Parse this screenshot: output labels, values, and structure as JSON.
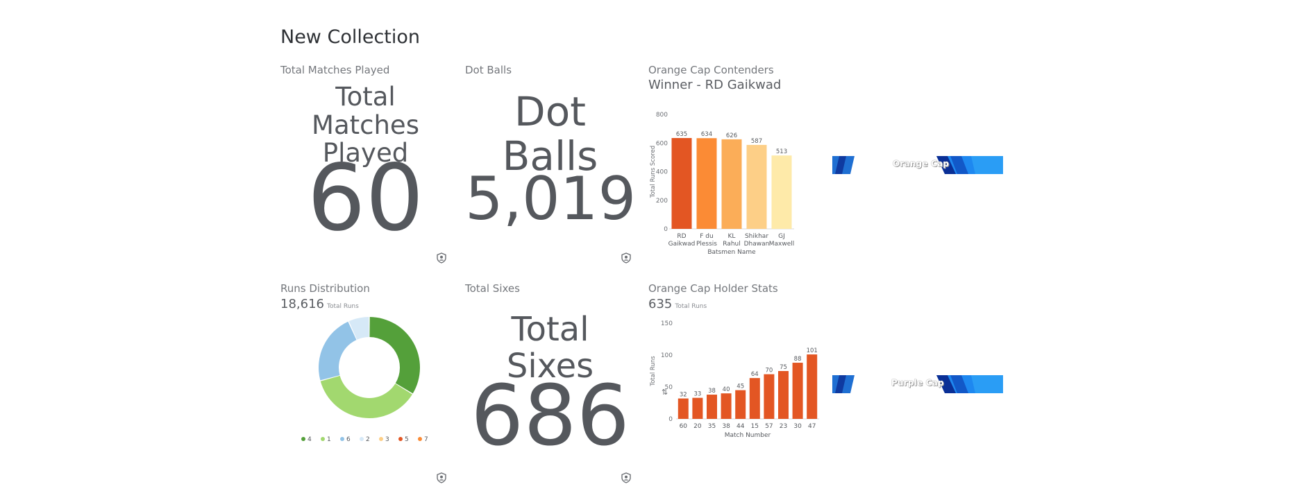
{
  "page_title": "New Collection",
  "cards": {
    "matches": {
      "label": "Total Matches Played",
      "title_line1": "Total Matches",
      "title_line2": "Played",
      "value": "60"
    },
    "dot_balls": {
      "label": "Dot Balls",
      "title": "Dot Balls",
      "value": "5,019"
    },
    "orange_cap": {
      "label": "Orange Cap Contenders",
      "subtitle": "Winner - RD Gaikwad"
    },
    "runs_dist": {
      "label": "Runs Distribution",
      "total": "18,616",
      "total_unit": "Total Runs"
    },
    "sixes": {
      "label": "Total Sixes",
      "title": "Total Sixes",
      "value": "686"
    },
    "holder_stats": {
      "label": "Orange Cap Holder Stats",
      "total": "635",
      "total_unit": "Total Runs"
    }
  },
  "banners": {
    "orange": {
      "text": "Orange Cap"
    },
    "purple": {
      "text": "Purple Cap"
    }
  },
  "colors": {
    "orange_bar": "#e35623",
    "green": "#54a03a"
  },
  "chart_data": [
    {
      "type": "bar",
      "title": "",
      "xlabel": "Batsmen Name",
      "ylabel": "Total Runs Scored",
      "ylim": [
        0,
        800
      ],
      "yticks": [
        "0",
        "200",
        "400",
        "600",
        "800"
      ],
      "categories": [
        [
          "RD",
          "Gaikwad"
        ],
        [
          "F du",
          "Plessis"
        ],
        [
          "KL",
          "Rahul"
        ],
        [
          "Shikhar",
          "Dhawan"
        ],
        [
          "GJ",
          "Maxwell"
        ]
      ],
      "values": [
        635,
        634,
        626,
        587,
        513
      ],
      "value_labels": [
        "635",
        "634",
        "626",
        "587",
        "513"
      ],
      "colors": [
        "#e35623",
        "#fb8b35",
        "#fbad58",
        "#fdcf87",
        "#feeaa9"
      ],
      "grid": false
    },
    {
      "type": "pie",
      "donut": true,
      "categories": [
        "4",
        "1",
        "6",
        "2",
        "3",
        "5",
        "7"
      ],
      "values": [
        30,
        33,
        20,
        6,
        0,
        0,
        0
      ],
      "colors": [
        "#54a03a",
        "#a2d86f",
        "#92c3e7",
        "#d6e9f7",
        "#fdcf87",
        "#e35623",
        "#fb8b35"
      ],
      "legend": "bottom"
    },
    {
      "type": "bar",
      "title": "",
      "xlabel": "Match Number",
      "ylabel": "Total Runs",
      "ylim": [
        0,
        150
      ],
      "yticks": [
        "0",
        "50",
        "100",
        "150"
      ],
      "categories": [
        "60",
        "20",
        "35",
        "38",
        "44",
        "15",
        "57",
        "23",
        "30",
        "47"
      ],
      "values": [
        32,
        33,
        38,
        40,
        45,
        64,
        70,
        75,
        88,
        101
      ],
      "value_labels": [
        "32",
        "33",
        "38",
        "40",
        "45",
        "64",
        "70",
        "75",
        "88",
        "101"
      ],
      "colors": [
        "#e35623"
      ],
      "grid": false
    }
  ]
}
